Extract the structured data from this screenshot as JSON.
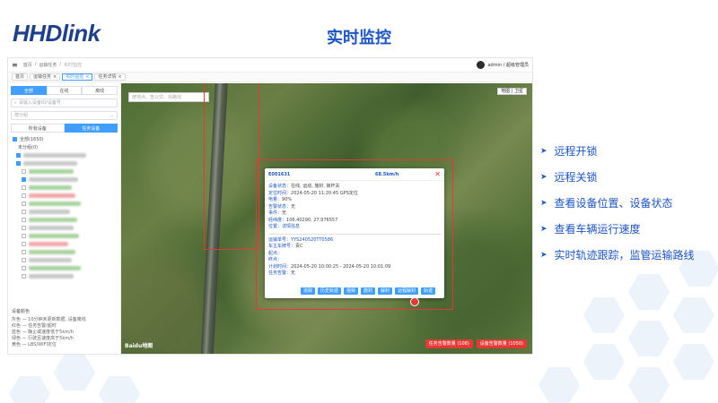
{
  "brand": {
    "logo_left": "HHD",
    "logo_right": "link"
  },
  "slide_title": "实时监控",
  "features": [
    "远程开锁",
    "远程关锁",
    "查看设备位置、设备状态",
    "查看车辆运行速度",
    "实时轨迹跟踪，监管运输路线"
  ],
  "app": {
    "menu_icon": "≡",
    "breadcrumb": [
      "首页",
      "/",
      "运输任务",
      "/",
      "实时监控"
    ],
    "user_name": "admin / 超级管理员",
    "tabs": [
      {
        "label": "首页",
        "active": false
      },
      {
        "label": "运输任务",
        "active": false
      },
      {
        "label": "实时监控",
        "active": true
      },
      {
        "label": "任务详情",
        "active": false
      }
    ],
    "tab_close": "×",
    "filter_tabs": [
      {
        "label": "全部",
        "active": true
      },
      {
        "label": "在线",
        "active": false
      },
      {
        "label": "离线",
        "active": false
      }
    ],
    "search_placeholder": "请输入设备ID/设备号",
    "group_select": "按分组",
    "device_tabs": [
      {
        "label": "所有设备",
        "active": false
      },
      {
        "label": "任务设备",
        "active": true
      }
    ],
    "tree_root": "全部(1650)",
    "tree_node": "未分组(0)",
    "legend_title": "设备颜色",
    "legend_items": [
      "灰色 — 10分钟未更新数据, 设备离线",
      "红色 — 任务告警/超时",
      "蓝色 — 静止或速度低于5km/h",
      "绿色 — 行驶且速度高于5km/h",
      "黄色 — LBS/WIFI定位"
    ],
    "map_search_placeholder": "搜地点、查公交、找路线",
    "map_type": "地图 | 卫星",
    "map_watermark": "Baidu地图",
    "popup": {
      "device_id": "E001631",
      "speed": "68.5km/h",
      "close": "✕",
      "status_lines": [
        {
          "label": "设备状态：",
          "value": "在线, 运动, 施封, 锁杆关"
        },
        {
          "label": "定位时间：",
          "value": "2024-05-20 11:20:45 GPS定位"
        },
        {
          "label": "电量：",
          "value": "90%"
        },
        {
          "label": "告警状态：",
          "value": "无"
        },
        {
          "label": "事件：",
          "value": "无"
        },
        {
          "label": "经纬度：",
          "value": "106.40290, 27.976557"
        },
        {
          "label": "位置：",
          "value": "详情信息"
        }
      ],
      "task_lines": [
        {
          "label": "运输单号：",
          "value": "YYS240520TT0586"
        },
        {
          "label": "车主车牌号：",
          "value": "贵C"
        },
        {
          "label": "起点：",
          "value": ""
        },
        {
          "label": "终点：",
          "value": ""
        },
        {
          "label": "计划时间：",
          "value": "2024-05-20 10:00:25 - 2024-05-20 10:01:09"
        },
        {
          "label": "任务告警：",
          "value": "无"
        }
      ],
      "buttons": [
        "追踪",
        "历史轨迹",
        "视频",
        "施封",
        "解封",
        "远程解封",
        "轨迹"
      ]
    },
    "alarm_buttons": [
      "任务告警数量 (108)",
      "设备告警数量 (1050)"
    ],
    "colors": {
      "primary": "#409eff",
      "alarm": "#e53935",
      "accent_blue": "#1d55c4"
    }
  }
}
